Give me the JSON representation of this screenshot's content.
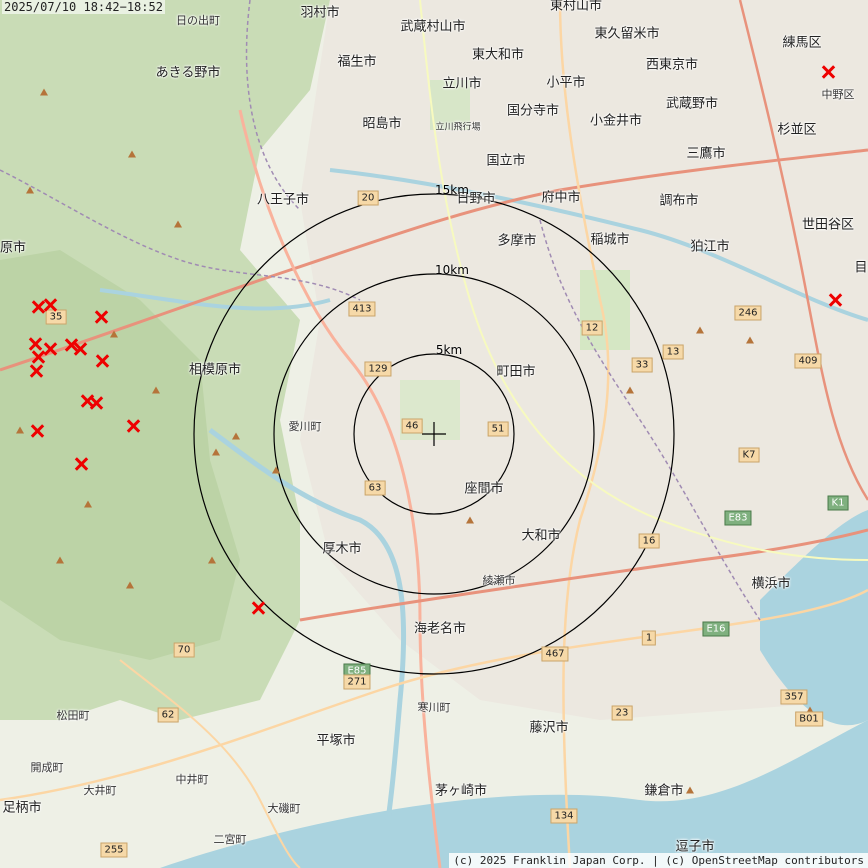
{
  "timestamp": "2025/07/10 18:42−18:52",
  "attribution": "(c) 2025 Franklin Japan Corp. | (c) OpenStreetMap contributors",
  "rings": [
    "5km",
    "10km",
    "15km"
  ],
  "cities": [
    {
      "name": "羽村市"
    },
    {
      "name": "武蔵村山市"
    },
    {
      "name": "東村山市"
    },
    {
      "name": "東久留米市"
    },
    {
      "name": "練馬区"
    },
    {
      "name": "日の出町"
    },
    {
      "name": "福生市"
    },
    {
      "name": "東大和市"
    },
    {
      "name": "西東京市"
    },
    {
      "name": "あきる野市"
    },
    {
      "name": "立川市"
    },
    {
      "name": "小平市"
    },
    {
      "name": "中野区"
    },
    {
      "name": "国分寺市"
    },
    {
      "name": "武蔵野市"
    },
    {
      "name": "昭島市"
    },
    {
      "name": "小金井市"
    },
    {
      "name": "杉並区"
    },
    {
      "name": "国立市"
    },
    {
      "name": "三鷹市"
    },
    {
      "name": "八王子市"
    },
    {
      "name": "日野市"
    },
    {
      "name": "府中市"
    },
    {
      "name": "調布市"
    },
    {
      "name": "世田谷区"
    },
    {
      "name": "多摩市"
    },
    {
      "name": "稲城市"
    },
    {
      "name": "狛江市"
    },
    {
      "name": "原市"
    },
    {
      "name": "町田市"
    },
    {
      "name": "相模原市"
    },
    {
      "name": "愛川町"
    },
    {
      "name": "座間市"
    },
    {
      "name": "大和市"
    },
    {
      "name": "厚木市"
    },
    {
      "name": "綾瀬市"
    },
    {
      "name": "横浜市"
    },
    {
      "name": "海老名市"
    },
    {
      "name": "寒川町"
    },
    {
      "name": "松田町"
    },
    {
      "name": "平塚市"
    },
    {
      "name": "藤沢市"
    },
    {
      "name": "開成町"
    },
    {
      "name": "大井町"
    },
    {
      "name": "中井町"
    },
    {
      "name": "足柄市"
    },
    {
      "name": "茅ヶ崎市"
    },
    {
      "name": "鎌倉市"
    },
    {
      "name": "大磯町"
    },
    {
      "name": "二宮町"
    },
    {
      "name": "逗子市"
    },
    {
      "name": "目"
    },
    {
      "name": "立川飛行場"
    }
  ],
  "routes": [
    "413",
    "129",
    "46",
    "51",
    "12",
    "13",
    "246",
    "409",
    "33",
    "63",
    "16",
    "467",
    "1",
    "23",
    "70",
    "62",
    "255",
    "134",
    "20",
    "35",
    "K7",
    "E83",
    "K1",
    "E16",
    "357",
    "B01",
    "E85",
    "271"
  ]
}
